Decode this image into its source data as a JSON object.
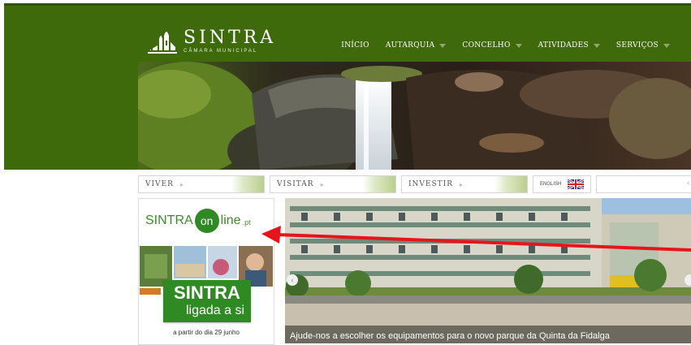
{
  "brand": {
    "title": "SINTRA",
    "subtitle": "CÂMARA MUNICIPAL"
  },
  "nav": {
    "items": [
      {
        "label": "INÍCIO",
        "has_caret": false
      },
      {
        "label": "AUTARQUIA",
        "has_caret": true
      },
      {
        "label": "CONCELHO",
        "has_caret": true
      },
      {
        "label": "ATIVIDADES",
        "has_caret": true
      },
      {
        "label": "SERVIÇOS",
        "has_caret": true
      }
    ]
  },
  "subnav": {
    "tabs": [
      {
        "label": "VIVER"
      },
      {
        "label": "VISITAR"
      },
      {
        "label": "INVESTIR"
      }
    ],
    "language": "ENGLISH"
  },
  "promo": {
    "logo_left": "SINTRA",
    "logo_on": "on",
    "logo_right": "line",
    "logo_tld": ".pt",
    "badge_title": "SINTRA",
    "badge_sub": "ligada a si",
    "date_text": "a partir do dia 29 junho"
  },
  "slideshow": {
    "caption": "Ajude-nos a escolher os equipamentos para o novo parque da Quinta da Fidalga"
  },
  "colors": {
    "header_green": "#3e6a0c",
    "promo_green": "#2f8a24",
    "annotation_red": "#e8141b"
  },
  "icons": {
    "flag": "uk-flag-icon",
    "prev": "chevron-left-icon",
    "next": "chevron-right-icon"
  }
}
